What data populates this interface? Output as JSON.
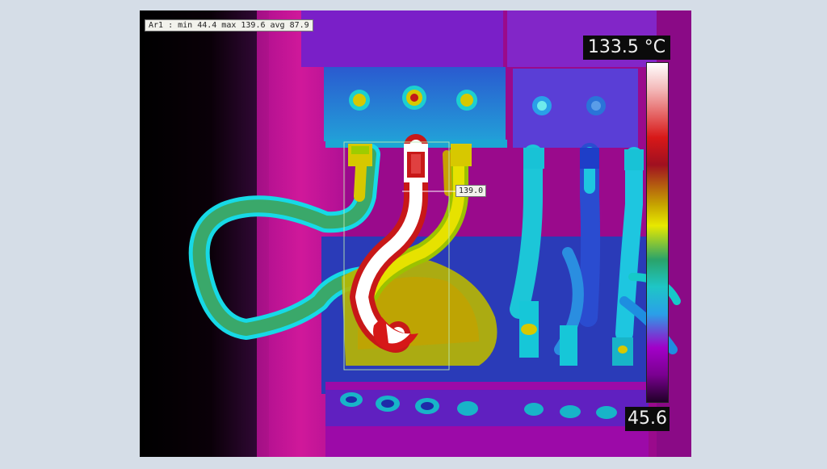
{
  "overlay": {
    "area_label": "Ar1 : min 44.4 max 139.6 avg 87.9",
    "spot_label": "139.0"
  },
  "scale": {
    "max_label": "133.5 °C",
    "min_label": "45.6",
    "palette": [
      "#ffffff",
      "#d81818",
      "#e8e800",
      "#1ec6c6",
      "#a200c8",
      "#200028"
    ]
  }
}
